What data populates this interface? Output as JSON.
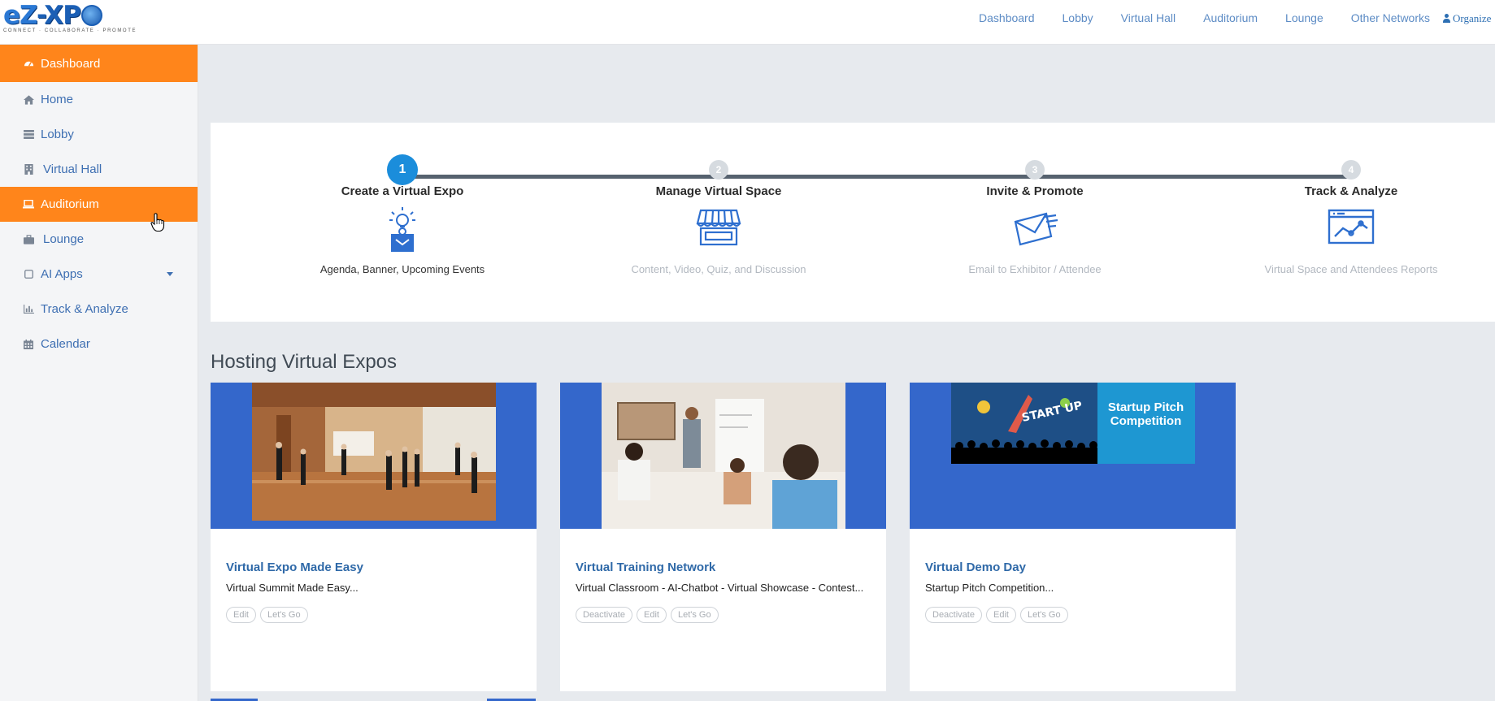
{
  "brand": {
    "logo_text": "eZ-XPO",
    "tagline": "CONNECT · COLLABORATE · PROMOTE"
  },
  "topnav": {
    "items": [
      "Dashboard",
      "Lobby",
      "Virtual Hall",
      "Auditorium",
      "Lounge",
      "Other Networks"
    ],
    "user_label": "Organize"
  },
  "sidebar": {
    "items": [
      {
        "label": "Dashboard",
        "icon": "dashboard-icon",
        "active": true
      },
      {
        "label": "Home",
        "icon": "home-icon",
        "active": false
      },
      {
        "label": "Lobby",
        "icon": "list-icon",
        "active": false
      },
      {
        "label": "Virtual Hall",
        "icon": "building-icon",
        "active": false
      },
      {
        "label": "Auditorium",
        "icon": "laptop-icon",
        "active": true
      },
      {
        "label": "Lounge",
        "icon": "briefcase-icon",
        "active": false
      },
      {
        "label": "AI Apps",
        "icon": "square-icon",
        "active": false,
        "has_dropdown": true
      },
      {
        "label": "Track & Analyze",
        "icon": "bar-chart-icon",
        "active": false
      },
      {
        "label": "Calendar",
        "icon": "calendar-icon",
        "active": false
      }
    ]
  },
  "steps": [
    {
      "number": "1",
      "title": "Create a Virtual Expo",
      "desc": "Agenda, Banner, Upcoming Events",
      "icon": "lightbulb-presenter-icon",
      "current": true
    },
    {
      "number": "2",
      "title": "Manage Virtual Space",
      "desc": "Content, Video, Quiz, and Discussion",
      "icon": "storefront-icon",
      "current": false
    },
    {
      "number": "3",
      "title": "Invite & Promote",
      "desc": "Email to Exhibitor / Attendee",
      "icon": "email-send-icon",
      "current": false
    },
    {
      "number": "4",
      "title": "Track & Analyze",
      "desc": "Virtual Space and Attendees Reports",
      "icon": "analytics-window-icon",
      "current": false
    }
  ],
  "section": {
    "title": "Hosting Virtual Expos"
  },
  "cards": [
    {
      "name": "Virtual Expo Made Easy",
      "subtitle": "Virtual Summit Made Easy...",
      "buttons": [
        "Edit",
        "Let's Go"
      ],
      "image": "expo-lobby-photo"
    },
    {
      "name": "Virtual Training Network",
      "subtitle": "Virtual Classroom - AI-Chatbot - Virtual Showcase - Contest...",
      "buttons": [
        "Deactivate",
        "Edit",
        "Let's Go"
      ],
      "image": "classroom-photo"
    },
    {
      "name": "Virtual Demo Day",
      "subtitle": "Startup Pitch Competition...",
      "buttons": [
        "Deactivate",
        "Edit",
        "Let's Go"
      ],
      "image": "startup-pitch-banner",
      "banner_text": "Startup Pitch Competition",
      "banner_art_text": "START UP"
    }
  ],
  "colors": {
    "accent": "#ff851b",
    "primary_blue": "#3467cb",
    "step_active": "#1b8ddb",
    "link": "#2f69a8"
  }
}
